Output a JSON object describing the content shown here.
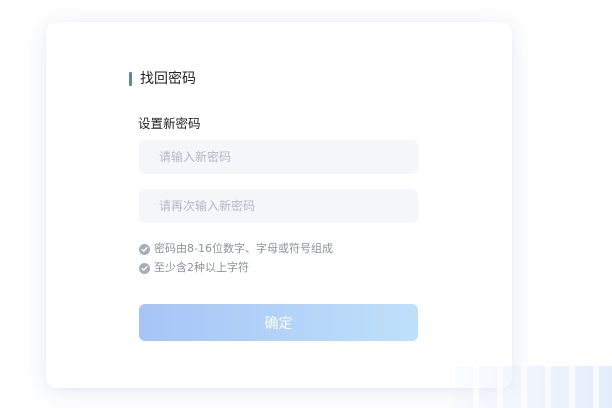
{
  "page": {
    "title": "找回密码",
    "section_label": "设置新密码"
  },
  "form": {
    "new_password": {
      "value": "",
      "placeholder": "请输入新密码"
    },
    "confirm_password": {
      "value": "",
      "placeholder": "请再次输入新密码"
    },
    "rules": [
      {
        "text": "密码由8-16位数字、字母或符号组成",
        "icon": "check-circle-icon"
      },
      {
        "text": "至少含2种以上字符",
        "icon": "check-circle-icon"
      }
    ],
    "submit_label": "确定"
  },
  "colors": {
    "accent_bar": "#5f85a6",
    "input_bg": "#f4f6fa",
    "rule_icon": "#a8adb8",
    "rule_text": "#8c919b",
    "button_gradient_start": "#a7c4f7",
    "button_gradient_end": "#bfe0fb"
  }
}
